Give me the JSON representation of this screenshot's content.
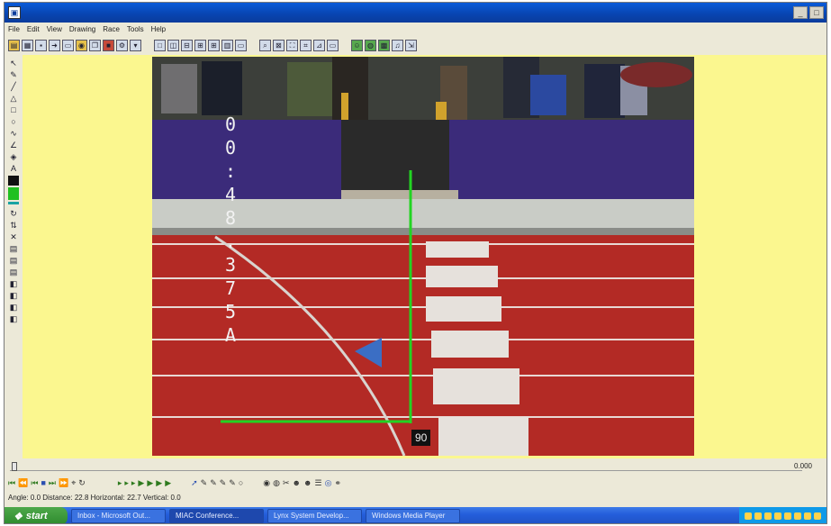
{
  "window": {
    "title": "",
    "buttons": {
      "minimize": "_",
      "maximize": "□",
      "close": "×"
    }
  },
  "menu": [
    "File",
    "Edit",
    "View",
    "Drawing",
    "Race",
    "Tools",
    "Help"
  ],
  "video": {
    "timer_chars": [
      "0",
      "0",
      ":",
      "4",
      "8",
      ".",
      "3",
      "7",
      "5",
      "A"
    ],
    "angle_label": "90"
  },
  "bottom": {
    "scrub_value": "0.000",
    "status": "Angle: 0.0   Distance: 22.8   Horizontal: 22.7   Vertical: 0.0"
  },
  "taskbar": {
    "start_label": "start",
    "tasks": [
      "Inbox - Microsoft Out...",
      "MIAC Conference...",
      "Lynx System Develop...",
      "Windows Media Player"
    ]
  },
  "colors": {
    "workspace": "#fbf78f",
    "track": "#b32a25",
    "finish_line": "#22d422"
  }
}
